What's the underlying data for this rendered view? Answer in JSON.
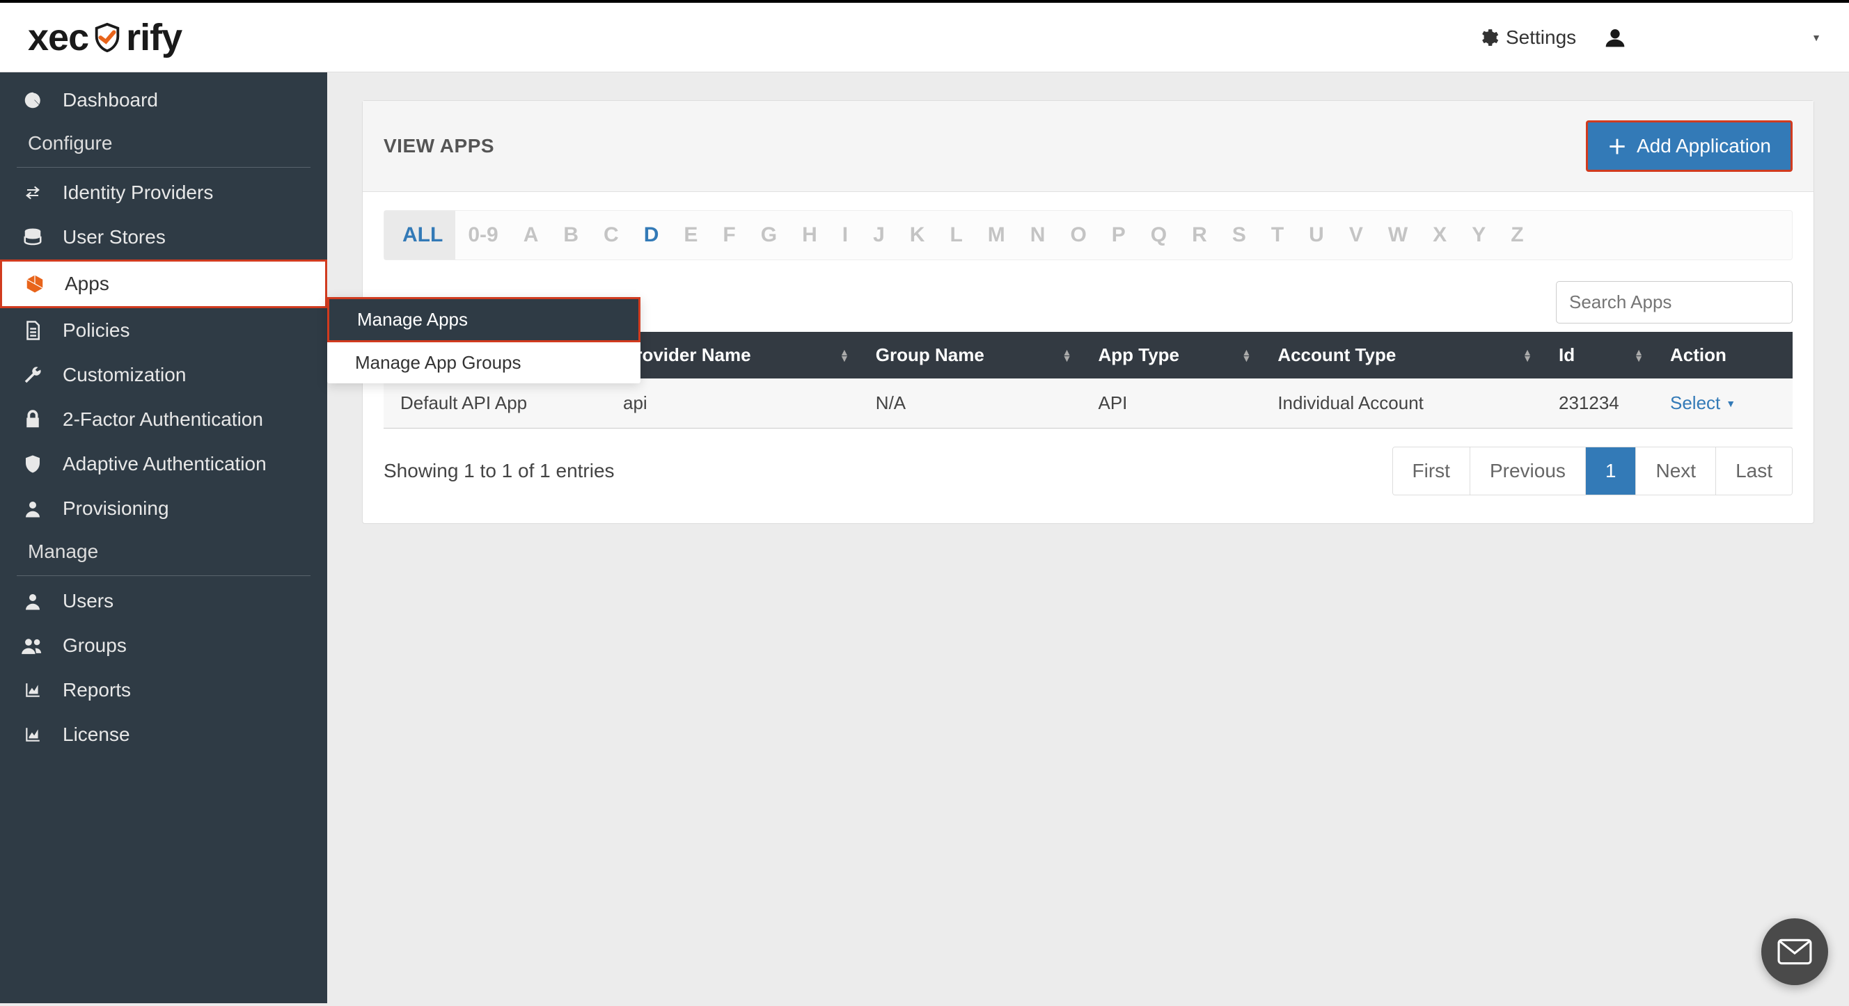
{
  "header": {
    "logo_text_left": "xec",
    "logo_text_right": "rify",
    "settings_label": "Settings"
  },
  "sidebar": {
    "items": [
      {
        "label": "Dashboard",
        "icon": "dashboard"
      }
    ],
    "configure_label": "Configure",
    "configure_items": [
      {
        "label": "Identity Providers",
        "icon": "exchange"
      },
      {
        "label": "User Stores",
        "icon": "database"
      },
      {
        "label": "Apps",
        "icon": "cube",
        "active": true
      },
      {
        "label": "Policies",
        "icon": "document"
      },
      {
        "label": "Customization",
        "icon": "wrench"
      },
      {
        "label": "2-Factor Authentication",
        "icon": "lock"
      },
      {
        "label": "Adaptive Authentication",
        "icon": "shield"
      },
      {
        "label": "Provisioning",
        "icon": "user"
      }
    ],
    "manage_label": "Manage",
    "manage_items": [
      {
        "label": "Users",
        "icon": "user"
      },
      {
        "label": "Groups",
        "icon": "users"
      },
      {
        "label": "Reports",
        "icon": "chart"
      },
      {
        "label": "License",
        "icon": "chart"
      }
    ],
    "flyout": {
      "items": [
        {
          "label": "Manage Apps",
          "active": true
        },
        {
          "label": "Manage App Groups",
          "active": false
        }
      ]
    }
  },
  "main": {
    "panel_title": "VIEW APPS",
    "add_button_label": "Add Application",
    "alpha_filter": {
      "all_label": "ALL",
      "items": [
        "0-9",
        "A",
        "B",
        "C",
        "D",
        "E",
        "F",
        "G",
        "H",
        "I",
        "J",
        "K",
        "L",
        "M",
        "N",
        "O",
        "P",
        "Q",
        "R",
        "S",
        "T",
        "U",
        "V",
        "W",
        "X",
        "Y",
        "Z"
      ],
      "selected": "D"
    },
    "search_placeholder": "Search Apps",
    "table": {
      "columns": [
        "",
        "Provider Name",
        "Group Name",
        "App Type",
        "Account Type",
        "Id",
        "Action"
      ],
      "rows": [
        {
          "name": "Default API App",
          "provider": "api",
          "group": "N/A",
          "app_type": "API",
          "account_type": "Individual Account",
          "id": "231234",
          "action": "Select"
        }
      ]
    },
    "entries_info": "Showing 1 to 1 of 1 entries",
    "pagination": {
      "first": "First",
      "previous": "Previous",
      "current": "1",
      "next": "Next",
      "last": "Last"
    }
  }
}
